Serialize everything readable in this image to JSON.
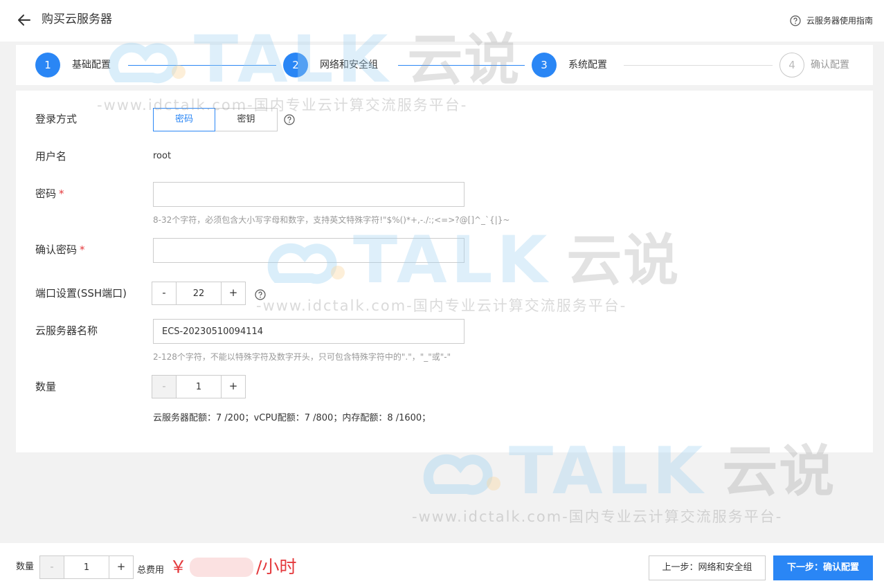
{
  "header": {
    "title": "购买云服务器",
    "help_label": "云服务器使用指南",
    "back_icon": "arrow-left-icon",
    "help_icon": "question-circle-icon"
  },
  "steps": [
    {
      "number": "1",
      "label": "基础配置",
      "state": "done"
    },
    {
      "number": "2",
      "label": "网络和安全组",
      "state": "done"
    },
    {
      "number": "3",
      "label": "系统配置",
      "state": "current"
    },
    {
      "number": "4",
      "label": "确认配置",
      "state": "pending"
    }
  ],
  "form": {
    "login_method": {
      "label": "登录方式",
      "options": [
        "密码",
        "密钥"
      ],
      "selected": "密码"
    },
    "username": {
      "label": "用户名",
      "value": "root"
    },
    "password": {
      "label": "密码",
      "required_mark": "*",
      "value": "",
      "hint": "8-32个字符，必须包含大小写字母和数字，支持英文特殊字符!\"$%()*+,-./:;<=>?@[]^_`{|}~"
    },
    "confirm_password": {
      "label": "确认密码",
      "required_mark": "*",
      "value": ""
    },
    "port": {
      "label": "端口设置(SSH端口)",
      "value": "22",
      "minus": "-",
      "plus": "+"
    },
    "server_name": {
      "label": "云服务器名称",
      "value": "ECS-20230510094114",
      "hint": "2-128个字符，不能以特殊字符及数字开头，只可包含特殊字符中的\".\"，\"_\"或\"-\""
    },
    "quantity": {
      "label": "数量",
      "value": "1",
      "minus": "-",
      "plus": "+"
    },
    "quota": "云服务器配额：7 /200；vCPU配额：7 /800；内存配额：8 /1600；"
  },
  "watermark": {
    "logo_text": "TALK",
    "logo_cn": "云说",
    "url_text": "-www.idctalk.com-国内专业云计算交流服务平台-"
  },
  "footer": {
    "quantity_label": "数量",
    "quantity_value": "1",
    "minus": "-",
    "plus": "+",
    "total_label": "总费用",
    "currency": "￥",
    "unit": "/小时",
    "prev_button": "上一步：网络和安全组",
    "next_button": "下一步：确认配置"
  },
  "colors": {
    "accent": "#2a86f5",
    "price": "#e4393c",
    "required": "#e4393c"
  }
}
